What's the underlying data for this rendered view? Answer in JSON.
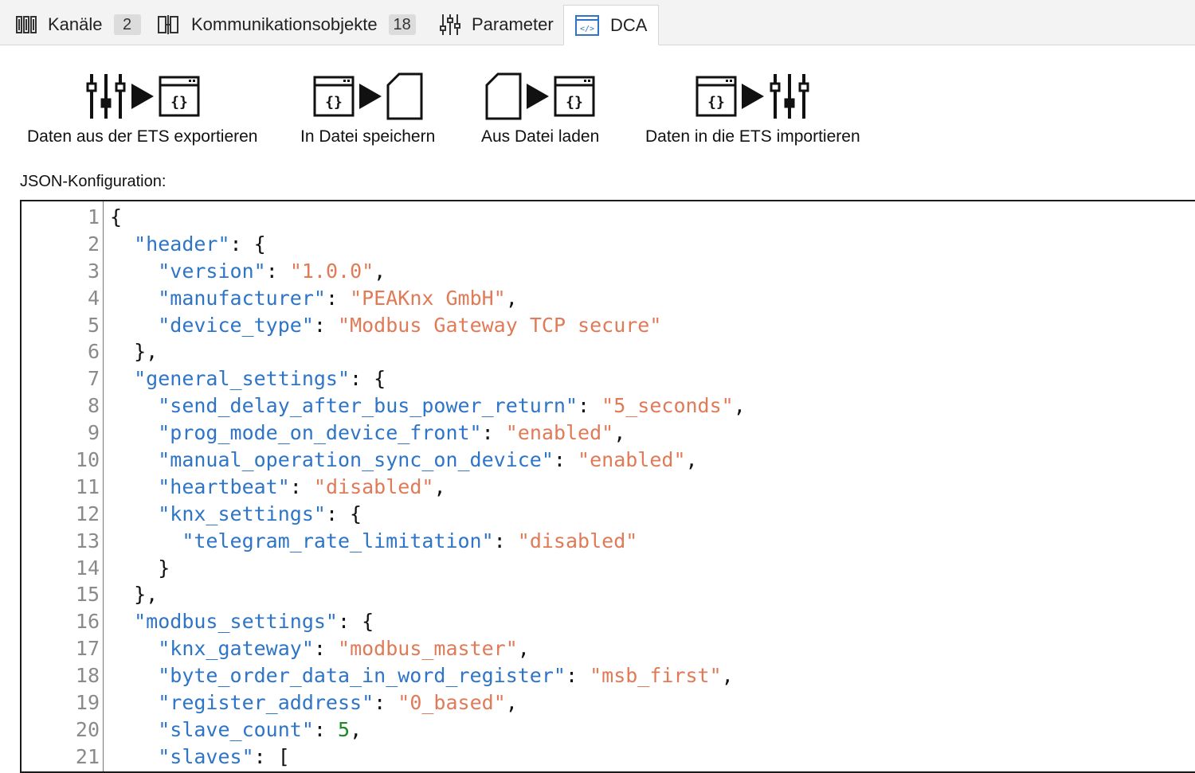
{
  "tabs": [
    {
      "label": "Kanäle",
      "badge": "2",
      "icon": "channels-icon"
    },
    {
      "label": "Kommunikationsobjekte",
      "badge": "18",
      "icon": "communication-objects-icon"
    },
    {
      "label": "Parameter",
      "badge": "",
      "icon": "sliders-icon"
    },
    {
      "label": "DCA",
      "badge": "",
      "icon": "code-window-icon",
      "active": true
    }
  ],
  "toolbar": [
    {
      "label": "Daten aus der ETS exportieren",
      "icons": [
        "sliders-icon",
        "play-arrow-icon",
        "code-window-icon"
      ]
    },
    {
      "label": "In Datei speichern",
      "icons": [
        "code-window-icon",
        "play-arrow-icon",
        "file-icon"
      ]
    },
    {
      "label": "Aus Datei laden",
      "icons": [
        "file-icon",
        "play-arrow-icon",
        "code-window-icon"
      ]
    },
    {
      "label": "Daten in die ETS importieren",
      "icons": [
        "code-window-icon",
        "play-arrow-icon",
        "sliders-icon"
      ]
    }
  ],
  "json_section": {
    "label": "JSON-Konfiguration:"
  },
  "colors": {
    "key": "#2e75c7",
    "string": "#e07a57",
    "number": "#1b8a24",
    "accent": "#2e75c7"
  },
  "editor": {
    "lines": [
      {
        "n": "1",
        "text": "{"
      },
      {
        "n": "2",
        "text": "  \"header\": {"
      },
      {
        "n": "3",
        "text": "    \"version\": \"1.0.0\","
      },
      {
        "n": "4",
        "text": "    \"manufacturer\": \"PEAKnx GmbH\","
      },
      {
        "n": "5",
        "text": "    \"device_type\": \"Modbus Gateway TCP secure\""
      },
      {
        "n": "6",
        "text": "  },"
      },
      {
        "n": "7",
        "text": "  \"general_settings\": {"
      },
      {
        "n": "8",
        "text": "    \"send_delay_after_bus_power_return\": \"5_seconds\","
      },
      {
        "n": "9",
        "text": "    \"prog_mode_on_device_front\": \"enabled\","
      },
      {
        "n": "10",
        "text": "    \"manual_operation_sync_on_device\": \"enabled\","
      },
      {
        "n": "11",
        "text": "    \"heartbeat\": \"disabled\","
      },
      {
        "n": "12",
        "text": "    \"knx_settings\": {"
      },
      {
        "n": "13",
        "text": "      \"telegram_rate_limitation\": \"disabled\""
      },
      {
        "n": "14",
        "text": "    }"
      },
      {
        "n": "15",
        "text": "  },"
      },
      {
        "n": "16",
        "text": "  \"modbus_settings\": {"
      },
      {
        "n": "17",
        "text": "    \"knx_gateway\": \"modbus_master\","
      },
      {
        "n": "18",
        "text": "    \"byte_order_data_in_word_register\": \"msb_first\","
      },
      {
        "n": "19",
        "text": "    \"register_address\": \"0_based\","
      },
      {
        "n": "20",
        "text": "    \"slave_count\": 5,"
      },
      {
        "n": "21",
        "text": "    \"slaves\": ["
      }
    ]
  }
}
